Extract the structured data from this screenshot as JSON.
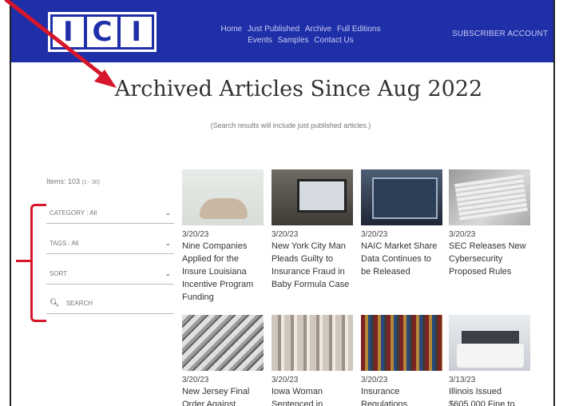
{
  "header": {
    "logo_letters": [
      "I",
      "C",
      "I"
    ],
    "nav_row1": [
      "Home",
      "Just Published",
      "Archive",
      "Full Editions"
    ],
    "nav_row2": [
      "Events",
      "Samples",
      "Contact Us"
    ],
    "subscriber_label": "SUBSCRIBER ACCOUNT",
    "bg_color": "#1f2fa8"
  },
  "page": {
    "title": "Archived Articles Since Aug 2022",
    "subtitle": "(Search results will include just published articles.)"
  },
  "sidebar": {
    "items_label": "Items: 103",
    "items_range": "(1 - 30)",
    "category_label": "CATEGORY : All",
    "tags_label": "TAGS : All",
    "sort_label": "SORT",
    "search_placeholder": "SEARCH"
  },
  "articles": [
    {
      "date": "3/20/23",
      "title": "Nine Companies Applied for the Insure Louisiana Incentive Program Funding",
      "image": "hospital-bed-photo"
    },
    {
      "date": "3/20/23",
      "title": "New York City Man Pleads Guilty to Insurance Fraud in Baby Formula Case",
      "image": "laptop-desk-photo"
    },
    {
      "date": "3/20/23",
      "title": "NAIC Market Share Data Continues to be Released",
      "image": "laptop-dashboard-photo"
    },
    {
      "date": "3/20/23",
      "title": "SEC Releases New Cybersecurity Proposed Rules",
      "image": "documents-photo"
    },
    {
      "date": "3/20/23",
      "title": "New Jersey Final Order Against",
      "image": "cash-bills-photo"
    },
    {
      "date": "3/20/23",
      "title": "Iowa Woman Sentenced in",
      "image": "columns-photo"
    },
    {
      "date": "3/20/23",
      "title": "Insurance Regulations",
      "image": "bookshelf-photo"
    },
    {
      "date": "3/13/23",
      "title": "Illinois Issued $605,000 Fine to",
      "image": "business-meeting-photo"
    }
  ],
  "annotations": {
    "color": "#d6162a"
  }
}
